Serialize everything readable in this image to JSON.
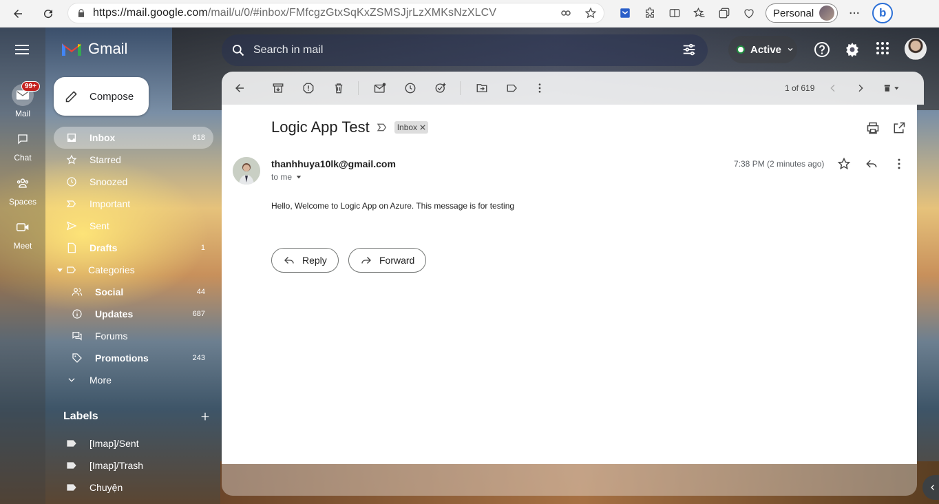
{
  "browser": {
    "url_host": "https://mail.google.com",
    "url_path": "/mail/u/0/#inbox/FMfcgzGtxSqKxZSMSJjrLzXMKsNzXLCV",
    "profile_label": "Personal"
  },
  "gmail": {
    "logo_text": "Gmail",
    "search_placeholder": "Search in mail",
    "status_label": "Active",
    "compose_label": "Compose"
  },
  "rail": {
    "mail_label": "Mail",
    "mail_badge": "99+",
    "chat_label": "Chat",
    "spaces_label": "Spaces",
    "meet_label": "Meet"
  },
  "nav": [
    {
      "label": "Inbox",
      "count": "618",
      "icon": "inbox-icon"
    },
    {
      "label": "Starred",
      "count": "",
      "icon": "star-icon"
    },
    {
      "label": "Snoozed",
      "count": "",
      "icon": "clock-icon"
    },
    {
      "label": "Important",
      "count": "",
      "icon": "important-icon"
    },
    {
      "label": "Sent",
      "count": "",
      "icon": "send-icon"
    },
    {
      "label": "Drafts",
      "count": "1",
      "icon": "draft-icon"
    },
    {
      "label": "Categories",
      "count": "",
      "icon": "label-icon"
    },
    {
      "label": "Social",
      "count": "44",
      "icon": "people-icon"
    },
    {
      "label": "Updates",
      "count": "687",
      "icon": "info-icon"
    },
    {
      "label": "Forums",
      "count": "",
      "icon": "forum-icon"
    },
    {
      "label": "Promotions",
      "count": "243",
      "icon": "tag-icon"
    },
    {
      "label": "More",
      "count": "",
      "icon": "chevron-down-icon"
    }
  ],
  "labels": {
    "heading": "Labels",
    "items": [
      "[Imap]/Sent",
      "[Imap]/Trash",
      "Chuyện"
    ]
  },
  "toolbar": {
    "pager": "1 of 619"
  },
  "message": {
    "subject": "Logic App Test",
    "tag": "Inbox",
    "sender": "thanhhuya10lk@gmail.com",
    "recipient": "to me",
    "time": "7:38 PM (2 minutes ago)",
    "body": "Hello, Welcome to Logic App on Azure. This message is for testing",
    "reply_label": "Reply",
    "forward_label": "Forward"
  },
  "colors": {
    "badge": "#c5221f",
    "active_dot": "#1e8e3e",
    "bing": "#2b6fd6"
  }
}
